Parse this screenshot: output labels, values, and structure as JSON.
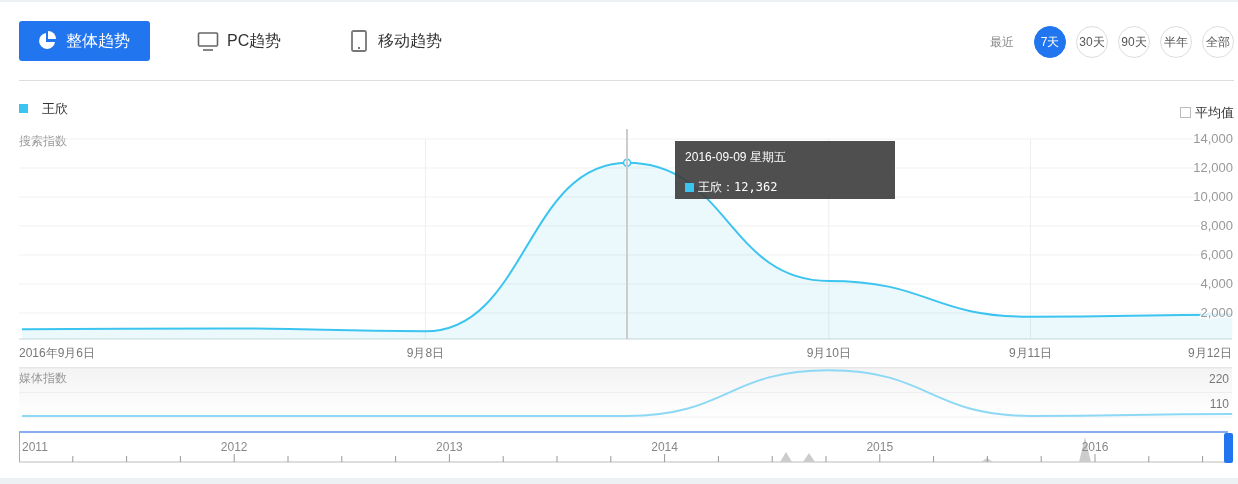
{
  "tabs": [
    {
      "label": "整体趋势",
      "kind": "pie",
      "selected": true
    },
    {
      "label": "PC趋势",
      "kind": "monitor",
      "selected": false
    },
    {
      "label": "移动趋势",
      "kind": "tablet",
      "selected": false
    }
  ],
  "range": {
    "label": "最近",
    "options": [
      {
        "label": "7天",
        "selected": true
      },
      {
        "label": "30天",
        "selected": false
      },
      {
        "label": "90天",
        "selected": false
      },
      {
        "label": "半年",
        "selected": false
      },
      {
        "label": "全部",
        "selected": false
      }
    ]
  },
  "legend": [
    {
      "name": "王欣",
      "color": "#3cc4f0"
    }
  ],
  "average": {
    "label": "平均值",
    "checked": false
  },
  "search_chart": {
    "chart_data": {
      "type": "area",
      "title": "搜索指数",
      "categories": [
        "2016年9月6日",
        null,
        "9月8日",
        null,
        "9月10日",
        "9月11日",
        "9月12日"
      ],
      "ylim": [
        200,
        14000
      ],
      "grid": true,
      "yticks": [
        {
          "value": 2000,
          "label": "2,000"
        },
        {
          "value": 4000,
          "label": "4,000"
        },
        {
          "value": 6000,
          "label": "6,000"
        },
        {
          "value": 8000,
          "label": "8,000"
        },
        {
          "value": 10000,
          "label": "10,000"
        },
        {
          "value": 12000,
          "label": "12,000"
        },
        {
          "value": 14000,
          "label": "14,000"
        }
      ],
      "series": [
        {
          "color": "#3cc4f0",
          "values": [
            870,
            930,
            730,
            12362,
            4200,
            1730,
            1870
          ]
        }
      ]
    },
    "tooltip": {
      "title": "2016-09-09 星期五",
      "item": "王欣：12,362"
    }
  },
  "media_chart": {
    "chart_data": {
      "type": "line",
      "title": "媒体指数",
      "ylim": [
        0,
        220
      ],
      "yticks": [
        {
          "value": 110,
          "label": "110"
        },
        {
          "value": 220,
          "label": "220"
        }
      ],
      "series": [
        {
          "color": "#8dd9f5",
          "values": [
            5,
            5,
            5,
            5,
            210,
            5,
            13
          ]
        }
      ]
    }
  },
  "navigator": {
    "years": [
      "2011",
      "2012",
      "2013",
      "2014",
      "2015",
      "2016"
    ]
  }
}
